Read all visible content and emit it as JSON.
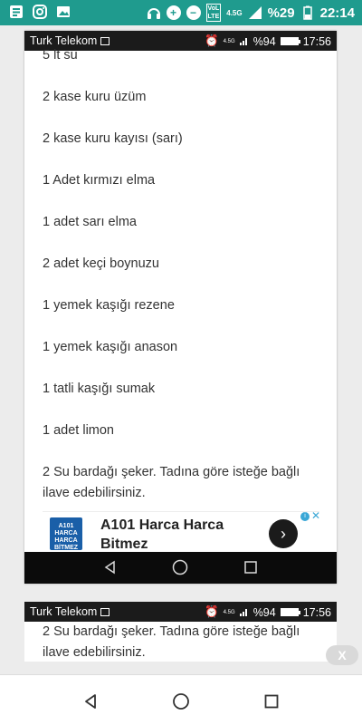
{
  "status_bar": {
    "battery_text": "%29",
    "time": "22:14",
    "network": "4.5G",
    "lte_label": "LTE",
    "vol_label": "VoL",
    "icons": [
      "notification-icon",
      "instagram-icon",
      "gallery-icon",
      "headphones-icon",
      "data-saver-icon",
      "do-not-disturb-icon",
      "lte-icon",
      "signal-icon",
      "battery-icon"
    ]
  },
  "inner_status": {
    "carrier": "Turk Telekom",
    "battery_text": "%94",
    "time": "17:56",
    "network": "4.5G"
  },
  "recipe": {
    "items": [
      "5 lt su",
      "2  kase kuru üzüm",
      "2  kase kuru kayısı (sarı)",
      "1 Adet kırmızı elma",
      "1 adet sarı elma",
      "2 adet keçi boynuzu",
      "1 yemek kaşığı rezene",
      "1 yemek kaşığı anason",
      "1 tatli kaşığı sumak",
      "1 adet limon"
    ],
    "sugar_line1": "2 Su bardağı şeker.  Tadına göre isteğe bağlı",
    "sugar_line2": "ilave edebilirsiniz."
  },
  "ad": {
    "logo_lines": [
      "A101",
      "HARCA",
      "HARCA",
      "BİTMEZ"
    ],
    "title_line1": "A101 Harca Harca",
    "title_line2": "Bitmez",
    "info_label": "i",
    "close_label": "✕",
    "arrow_label": "›"
  },
  "second_shot": {
    "carrier": "Turk Telekom",
    "battery_text": "%94",
    "time": "17:56",
    "network": "4.5G",
    "line1": "2 Su bardağı şeker.  Tadına göre isteğe bağlı",
    "line2": "ilave edebilirsiniz."
  },
  "dismiss_label": "X"
}
